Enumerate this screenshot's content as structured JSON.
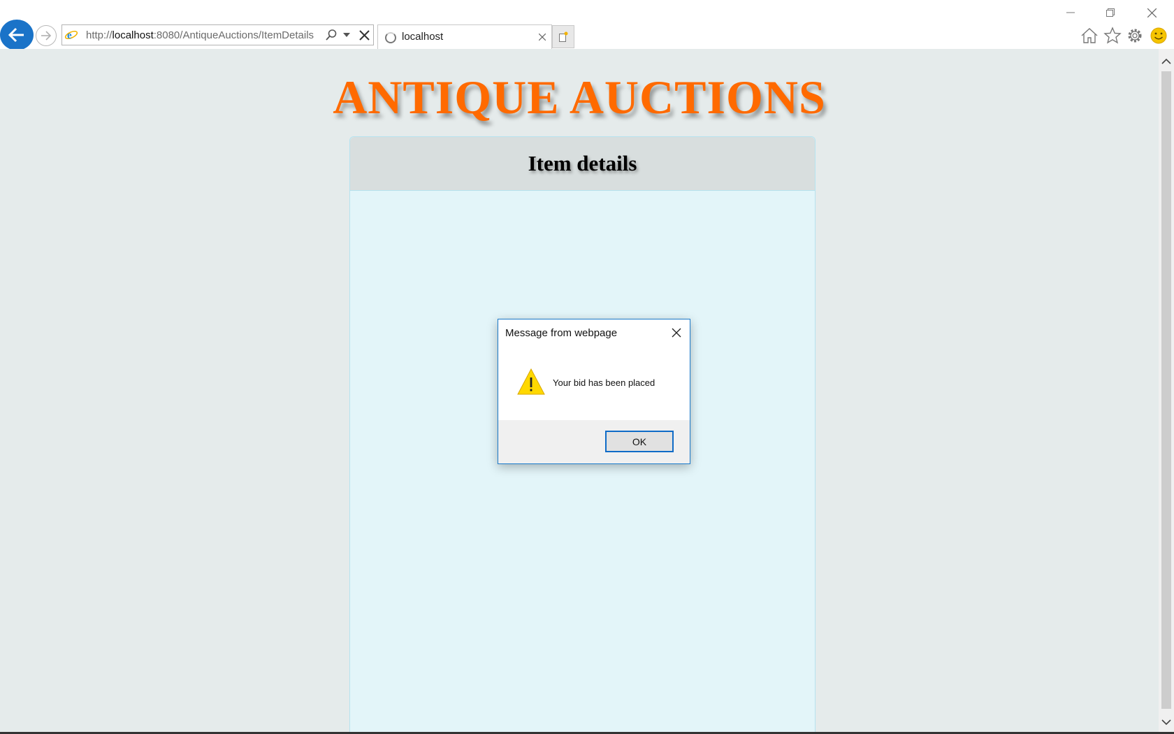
{
  "browser": {
    "address": {
      "scheme": "http://",
      "host": "localhost",
      "path": ":8080/AntiqueAuctions/ItemDetails"
    },
    "tab": {
      "title": "localhost"
    },
    "icons": [
      "back-arrow-icon",
      "forward-arrow-icon",
      "ie-logo-icon",
      "search-icon",
      "dropdown-icon",
      "stop-icon",
      "tab-close-icon",
      "new-tab-icon",
      "home-icon",
      "favorites-star-icon",
      "settings-gear-icon",
      "feedback-smiley-icon",
      "minimize-icon",
      "restore-icon",
      "close-icon"
    ]
  },
  "page": {
    "site_title": "ANTIQUE AUCTIONS",
    "panel_title": "Item details",
    "accent_color": "#ff6a00"
  },
  "dialog": {
    "title": "Message from webpage",
    "message": "Your bid has been placed",
    "ok_label": "OK",
    "icon": "warning-icon"
  }
}
